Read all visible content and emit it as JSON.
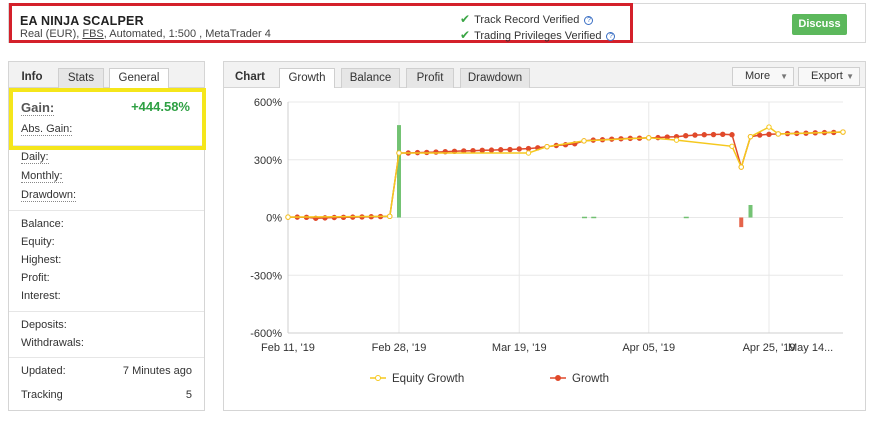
{
  "system": {
    "name": "EA NINJA SCALPER",
    "account_type": "Real (EUR), ",
    "broker": "FBS",
    "details": ", Automated, 1:500 , MetaTrader 4",
    "track_record": "Track Record Verified",
    "trading_privileges": "Trading Privileges Verified",
    "discuss": "Discuss"
  },
  "info": {
    "tabs": [
      "Info",
      "Stats",
      "General"
    ],
    "gain_label": "Gain:",
    "gain_value": "+444.58%",
    "abs_gain_label": "Abs. Gain:",
    "daily_label": "Daily:",
    "monthly_label": "Monthly:",
    "drawdown_label": "Drawdown:",
    "balance_label": "Balance:",
    "equity_label": "Equity:",
    "highest_label": "Highest:",
    "profit_label": "Profit:",
    "interest_label": "Interest:",
    "deposits_label": "Deposits:",
    "withdrawals_label": "Withdrawals:",
    "updated_label": "Updated:",
    "updated_value": "7 Minutes ago",
    "tracking_label": "Tracking",
    "tracking_value": "5"
  },
  "chart_panel": {
    "title": "Chart",
    "tabs": [
      "Growth",
      "Balance",
      "Profit",
      "Drawdown"
    ],
    "active_tab": "Growth",
    "more": "More",
    "export": "Export"
  },
  "colors": {
    "growth": "#e0492a",
    "equity": "#f5c81e",
    "bar_up": "#5cb85c",
    "bar_down": "#e0492a"
  },
  "chart_data": {
    "type": "line",
    "x_ticks": [
      "Feb 11, '19",
      "Feb 28, '19",
      "Mar 19, '19",
      "Apr 05, '19",
      "Apr 25, '19",
      "May 14..."
    ],
    "y_ticks": [
      "600%",
      "300%",
      "0%",
      "-300%",
      "-600%"
    ],
    "ylim": [
      -600,
      600
    ],
    "legend": [
      "Equity Growth",
      "Growth"
    ],
    "legend_position": "bottom",
    "x_index_range": [
      0,
      92
    ],
    "series": [
      {
        "name": "Growth",
        "points": [
          [
            0,
            2
          ],
          [
            2,
            2
          ],
          [
            4,
            1
          ],
          [
            6,
            -4
          ],
          [
            8,
            -2
          ],
          [
            10,
            0
          ],
          [
            12,
            1
          ],
          [
            14,
            2
          ],
          [
            16,
            3
          ],
          [
            18,
            4
          ],
          [
            20,
            5
          ],
          [
            22,
            6
          ],
          [
            24,
            335
          ],
          [
            26,
            335
          ],
          [
            28,
            337
          ],
          [
            30,
            338
          ],
          [
            32,
            340
          ],
          [
            34,
            342
          ],
          [
            36,
            344
          ],
          [
            38,
            346
          ],
          [
            40,
            347
          ],
          [
            42,
            349
          ],
          [
            44,
            350
          ],
          [
            46,
            352
          ],
          [
            48,
            353
          ],
          [
            50,
            356
          ],
          [
            52,
            358
          ],
          [
            54,
            362
          ],
          [
            56,
            368
          ],
          [
            58,
            374
          ],
          [
            60,
            378
          ],
          [
            62,
            383
          ],
          [
            64,
            398
          ],
          [
            66,
            402
          ],
          [
            68,
            404
          ],
          [
            70,
            407
          ],
          [
            72,
            409
          ],
          [
            74,
            411
          ],
          [
            76,
            412
          ],
          [
            78,
            414
          ],
          [
            80,
            415
          ],
          [
            82,
            418
          ],
          [
            84,
            420
          ],
          [
            86,
            425
          ],
          [
            88,
            428
          ],
          [
            90,
            430
          ],
          [
            92,
            431
          ],
          [
            94,
            432
          ],
          [
            96,
            430
          ],
          [
            98,
            262
          ],
          [
            100,
            420
          ],
          [
            102,
            428
          ],
          [
            104,
            432
          ],
          [
            106,
            434
          ],
          [
            108,
            436
          ],
          [
            110,
            437
          ],
          [
            112,
            438
          ],
          [
            114,
            440
          ],
          [
            116,
            441
          ],
          [
            118,
            442
          ],
          [
            120,
            444
          ]
        ]
      },
      {
        "name": "Equity Growth",
        "points": [
          [
            0,
            2
          ],
          [
            22,
            6
          ],
          [
            24,
            335
          ],
          [
            52,
            335
          ],
          [
            56,
            368
          ],
          [
            64,
            398
          ],
          [
            78,
            414
          ],
          [
            84,
            402
          ],
          [
            96,
            370
          ],
          [
            98,
            262
          ],
          [
            100,
            420
          ],
          [
            104,
            470
          ],
          [
            106,
            434
          ],
          [
            120,
            444
          ]
        ]
      }
    ],
    "bars": [
      {
        "x": 24,
        "value": 480
      },
      {
        "x": 64,
        "value": 4
      },
      {
        "x": 66,
        "value": 4
      },
      {
        "x": 86,
        "value": 4
      },
      {
        "x": 98,
        "value": -50
      },
      {
        "x": 100,
        "value": 65
      }
    ]
  }
}
